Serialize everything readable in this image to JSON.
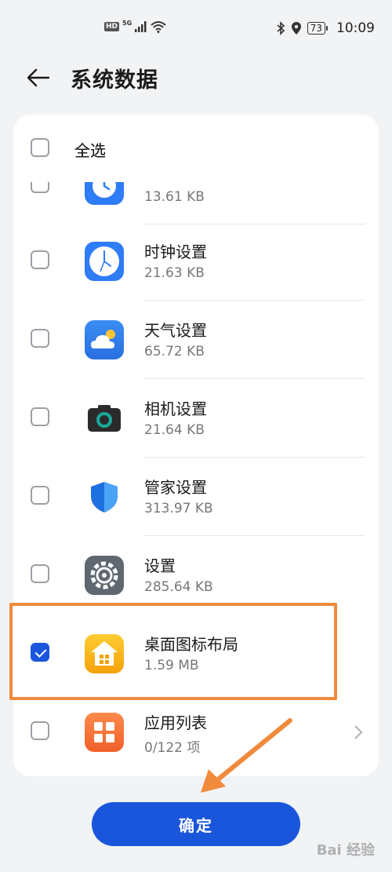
{
  "status_bar": {
    "signal_badge": "HD",
    "network_type": "5G",
    "battery_level": "73",
    "time": "10:09"
  },
  "header": {
    "title": "系统数据"
  },
  "list": {
    "select_all_label": "全选",
    "items": [
      {
        "name": "",
        "size": "13.61 KB",
        "icon": "alarm-icon",
        "checked": false
      },
      {
        "name": "时钟设置",
        "size": "21.63 KB",
        "icon": "clock-icon",
        "checked": false
      },
      {
        "name": "天气设置",
        "size": "65.72 KB",
        "icon": "weather-icon",
        "checked": false
      },
      {
        "name": "相机设置",
        "size": "21.64 KB",
        "icon": "camera-icon",
        "checked": false
      },
      {
        "name": "管家设置",
        "size": "313.97 KB",
        "icon": "shield-icon",
        "checked": false
      },
      {
        "name": "设置",
        "size": "285.64 KB",
        "icon": "settings-gear-icon",
        "checked": false
      },
      {
        "name": "桌面图标布局",
        "size": "1.59 MB",
        "icon": "home-layout-icon",
        "checked": true
      },
      {
        "name": "应用列表",
        "size": "0/122 项",
        "icon": "app-grid-icon",
        "checked": false
      }
    ]
  },
  "confirm_label": "确定",
  "watermark": "Bai 经验",
  "colors": {
    "accent": "#1a56db",
    "highlight": "#f08a3c",
    "background": "#f1f3f5"
  }
}
